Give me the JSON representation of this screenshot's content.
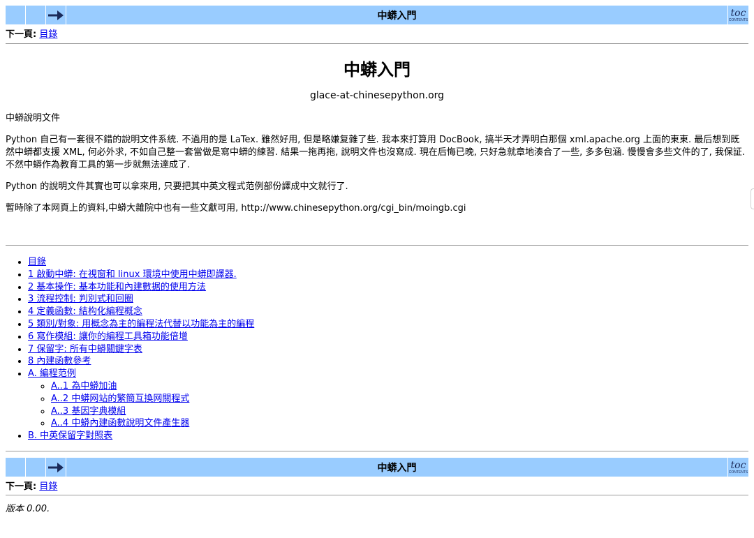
{
  "nav": {
    "title": "中蟒入門",
    "next_label": "下一頁:",
    "next_link": "目錄",
    "arrow_icon": "right-arrow-icon",
    "toc_icon_big": "toc",
    "toc_icon_small": "CONTENTS"
  },
  "doc": {
    "title": "中蟒入門",
    "author": "glace-at-chinesepython.org",
    "paragraphs": [
      "中蟒說明文件",
      "Python 自己有一套很不錯的說明文件系統. 不過用的是 LaTex. 雖然好用, 但是略嫌复雜了些. 我本來打算用 DocBook, 搞半天才弄明白那個 xml.apache.org 上面的東東. 最后想到既然中蟒都支援 XML, 何必外求, 不如自己整一套當做是寫中蟒的練習. 結果一拖再拖, 說明文件也沒寫成. 現在后悔已晚, 只好急就章地湊合了一些, 多多包涵. 慢慢會多些文件的了, 我保証. 不然中蟒作為教育工具的第一步就無法達成了.",
      "Python 的說明文件其實也可以拿來用, 只要把其中英文程式范例部份譯成中文就行了.",
      "暫時除了本网頁上的資料,中蟒大雜院中也有一些文獻可用, http://www.chinesepython.org/cgi_bin/moingb.cgi"
    ]
  },
  "toc": {
    "items": [
      "目錄",
      "1 啟動中蟒: 在視窗和 linux 環境中使用中蟒即譯器.",
      "2 基本操作: 基本功能和內建數据的使用方法",
      "3 流程控制: 判別式和回圈",
      "4 定義函數: 結构化編程概念",
      "5 類別/對象: 用概念為主的編程法代替以功能為主的編程",
      "6 寫作模組: 讓你的編程工具箱功能倍增",
      "7 保留字: 所有中蟒關鍵字表",
      "8 內建函數參考",
      "A. 編程范例"
    ],
    "sub_items": [
      "A..1 為中蟒加油",
      "A..2 中蟒网站的繁簡互換网關程式",
      "A..3 基因字典模組",
      "A..4 中蟒內建函數說明文件產生器"
    ],
    "last_item": "B. 中英保留字對照表"
  },
  "footer": {
    "version": "版本 0.00."
  },
  "colors": {
    "nav_background": "#99ccff",
    "link": "#0000ee",
    "rule": "#9a9a9a"
  }
}
